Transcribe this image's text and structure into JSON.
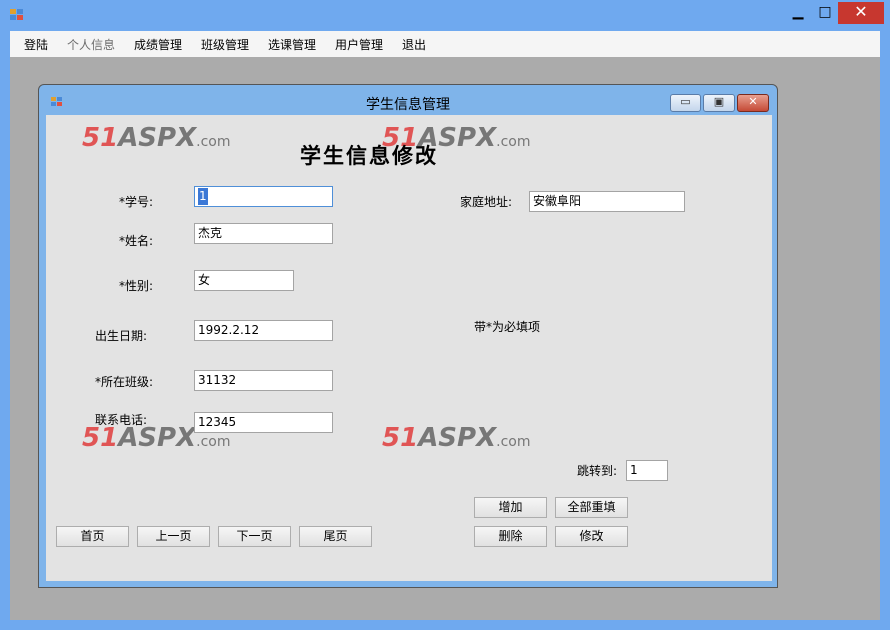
{
  "main_window": {
    "min_glyph": "▁",
    "max_glyph": "□",
    "close_glyph": "✕"
  },
  "menu": [
    "登陆",
    "个人信息",
    "成绩管理",
    "班级管理",
    "选课管理",
    "用户管理",
    "退出"
  ],
  "child_window": {
    "title": "学生信息管理",
    "min_glyph": "▭",
    "max_glyph": "▣",
    "close_glyph": "✕"
  },
  "watermark": {
    "num": "51",
    "word": "ASPX",
    "suffix": ".com"
  },
  "form": {
    "heading": "学生信息修改",
    "student_id_label": "*学号:",
    "student_id_value": "1",
    "name_label": "*姓名:",
    "name_value": "杰克",
    "gender_label": "*性别:",
    "gender_value": "女",
    "birth_label": "出生日期:",
    "birth_value": "1992.2.12",
    "class_label": "*所在班级:",
    "class_value": "31132",
    "phone_label": "联系电话:",
    "phone_value": "12345",
    "address_label": "家庭地址:",
    "address_value": "安徽阜阳",
    "required_note": "带*为必填项",
    "jump_label": "跳转到:",
    "jump_value": "1"
  },
  "buttons": {
    "add": "增加",
    "reset": "全部重填",
    "delete": "删除",
    "modify": "修改",
    "first": "首页",
    "prev": "上一页",
    "next": "下一页",
    "last": "尾页"
  }
}
